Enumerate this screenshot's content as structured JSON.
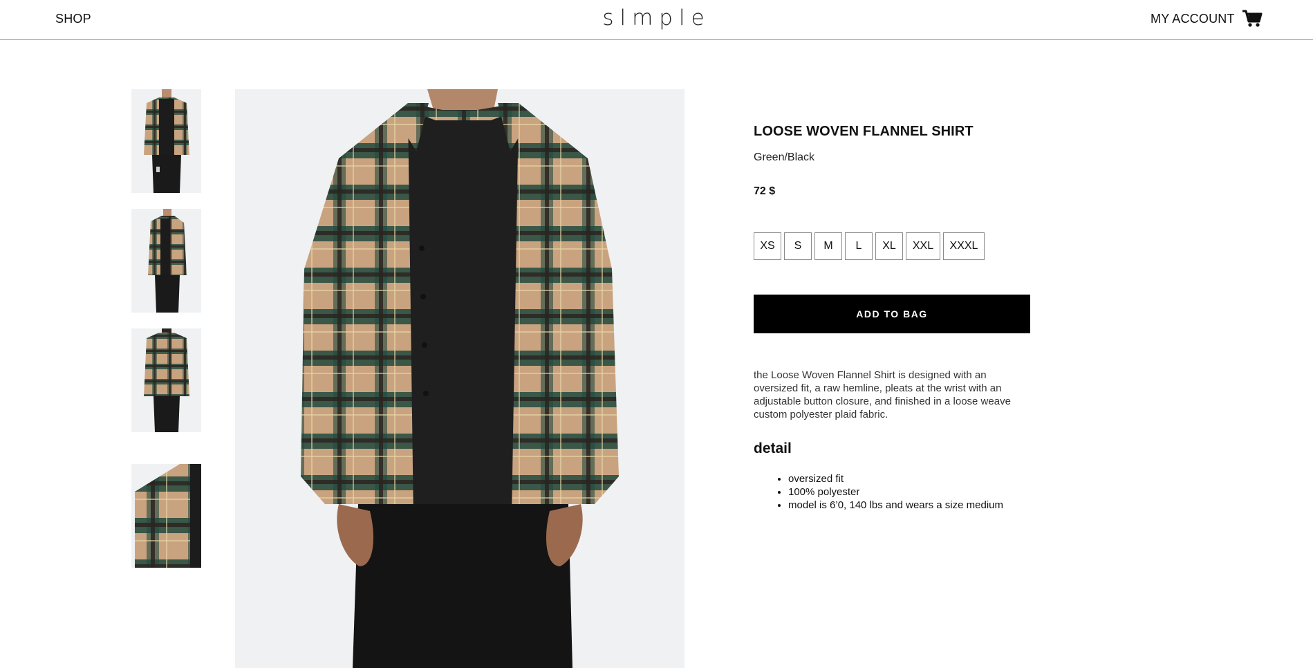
{
  "header": {
    "shop_label": "SHOP",
    "logo": "slmple",
    "account_label": "MY ACCOUNT",
    "cart_icon": "shopping-cart-icon"
  },
  "gallery": {
    "thumbnails": [
      {
        "view": "front-open"
      },
      {
        "view": "side"
      },
      {
        "view": "back"
      },
      {
        "view": "detail-closeup"
      }
    ],
    "main_image": {
      "view": "front-open"
    }
  },
  "product": {
    "title": "LOOSE WOVEN FLANNEL SHIRT",
    "color": "Green/Black",
    "price": "72 $",
    "sizes": [
      "XS",
      "S",
      "M",
      "L",
      "XL",
      "XXL",
      "XXXL"
    ],
    "add_to_bag_label": "ADD TO BAG",
    "description": "the Loose Woven Flannel Shirt is designed with an oversized fit, a raw hemline, pleats at the wrist with an adjustable button closure, and finished in a loose weave custom polyester plaid fabric.",
    "detail_heading": "detail",
    "details": [
      "oversized fit",
      "100% polyester",
      "model is 6’0, 140 lbs and wears a size medium"
    ]
  },
  "colors": {
    "background": "#ffffff",
    "image_bg": "#eff1f3",
    "plaid_tan": "#c9a37f",
    "plaid_green": "#214a3e",
    "plaid_dark": "#2b2521",
    "button_black": "#000000"
  }
}
